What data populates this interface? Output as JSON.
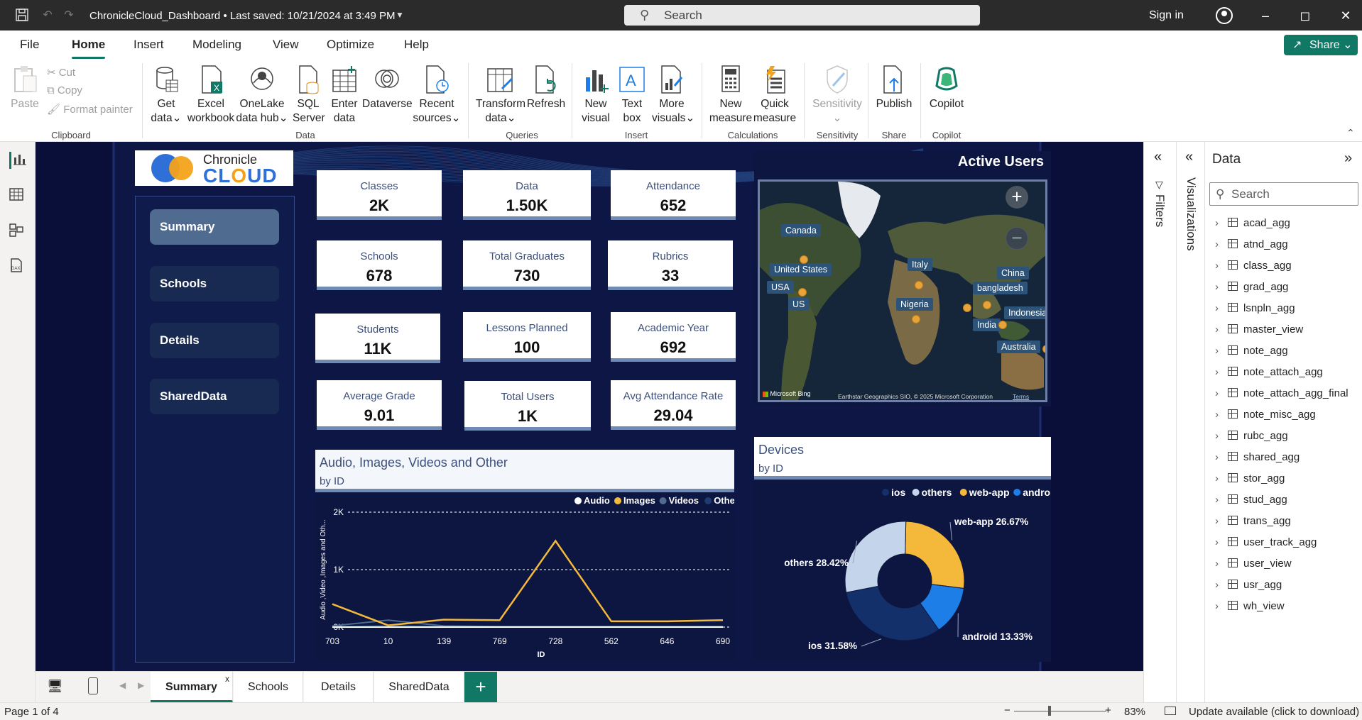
{
  "titlebar": {
    "title": "ChronicleCloud_Dashboard • Last saved: 10/21/2024 at 3:49 PM",
    "search_placeholder": "Search",
    "signin": "Sign in"
  },
  "menu": {
    "tabs": [
      "File",
      "Home",
      "Insert",
      "Modeling",
      "View",
      "Optimize",
      "Help"
    ],
    "share": "Share"
  },
  "ribbon": {
    "clipboard": {
      "paste": "Paste",
      "cut": "Cut",
      "copy": "Copy",
      "format_painter": "Format painter",
      "group": "Clipboard"
    },
    "data": {
      "get_data": [
        "Get",
        "data"
      ],
      "excel": [
        "Excel",
        "workbook"
      ],
      "onelake": [
        "OneLake",
        "data hub"
      ],
      "sql": [
        "SQL",
        "Server"
      ],
      "enter": [
        "Enter",
        "data"
      ],
      "dataverse": "Dataverse",
      "recent": [
        "Recent",
        "sources"
      ],
      "group": "Data"
    },
    "queries": {
      "transform": [
        "Transform",
        "data"
      ],
      "refresh": "Refresh",
      "group": "Queries"
    },
    "insert": {
      "new_visual": [
        "New",
        "visual"
      ],
      "text_box": [
        "Text",
        "box"
      ],
      "more_visuals": [
        "More",
        "visuals"
      ],
      "group": "Insert"
    },
    "calculations": {
      "new_measure": [
        "New",
        "measure"
      ],
      "quick_measure": [
        "Quick",
        "measure"
      ],
      "group": "Calculations"
    },
    "sensitivity": {
      "label": "Sensitivity",
      "group": "Sensitivity"
    },
    "share": {
      "publish": "Publish",
      "group": "Share"
    },
    "copilot": {
      "label": "Copilot",
      "group": "Copilot"
    }
  },
  "report": {
    "logo": {
      "line1": "Chronicle",
      "line2": "CL",
      "line3": "UD"
    },
    "nav": [
      "Summary",
      "Schools",
      "Details",
      "SharedData"
    ],
    "kpis": [
      {
        "label": "Classes",
        "value": "2K"
      },
      {
        "label": "Data",
        "value": "1.50K"
      },
      {
        "label": "Attendance",
        "value": "652"
      },
      {
        "label": "Schools",
        "value": "678"
      },
      {
        "label": "Total Graduates",
        "value": "730"
      },
      {
        "label": "Rubrics",
        "value": "33"
      },
      {
        "label": "Students",
        "value": "11K"
      },
      {
        "label": "Lessons Planned",
        "value": "100"
      },
      {
        "label": "Academic Year",
        "value": "692"
      },
      {
        "label": "Average Grade",
        "value": "9.01"
      },
      {
        "label": "Total Users",
        "value": "1K"
      },
      {
        "label": "Avg Attendance Rate",
        "value": "29.04"
      }
    ],
    "map": {
      "title": "Active Users",
      "labels": [
        "Canada",
        "United States",
        "USA",
        "US",
        "Italy",
        "Nigeria",
        "China",
        "bangladesh",
        "India",
        "Indonesia",
        "Australia"
      ],
      "attribution": "Microsoft Bing",
      "copyright": "Earthstar Geographics SIO, © 2025 Microsoft Corporation",
      "terms": "Terms"
    },
    "audio_chart": {
      "title": "Audio, Images, Videos and Other",
      "subtitle": "by ID"
    },
    "devices_chart": {
      "title": "Devices",
      "subtitle": "by ID"
    }
  },
  "chart_data": [
    {
      "type": "line",
      "title": "Audio, Images, Videos and Other",
      "subtitle": "by ID",
      "xlabel": "ID",
      "ylabel": "Audio ,Video ,Images and Oth...",
      "categories": [
        "703",
        "10",
        "139",
        "769",
        "728",
        "562",
        "646",
        "690"
      ],
      "yticks": [
        "0K",
        "1K",
        "2K"
      ],
      "ylim": [
        0,
        2000
      ],
      "grid": true,
      "legend_position": "top-right",
      "series": [
        {
          "name": "Audio",
          "color": "#ffffff",
          "values": [
            0,
            0,
            0,
            0,
            0,
            0,
            0,
            0
          ]
        },
        {
          "name": "Images",
          "color": "#f4b93a",
          "values": [
            400,
            30,
            130,
            120,
            1500,
            100,
            100,
            120
          ]
        },
        {
          "name": "Videos",
          "color": "#4f6b90",
          "values": [
            20,
            120,
            20,
            10,
            10,
            10,
            10,
            10
          ]
        },
        {
          "name": "Other",
          "color": "#1f3b73",
          "values": [
            0,
            30,
            10,
            0,
            0,
            0,
            0,
            0
          ]
        }
      ]
    },
    {
      "type": "pie",
      "title": "Devices",
      "subtitle": "by ID",
      "legend_position": "top-right",
      "slices": [
        {
          "name": "web-app",
          "label": "web-app 26.67%",
          "value": 26.67,
          "color": "#f4b93a"
        },
        {
          "name": "android",
          "label": "android 13.33%",
          "value": 13.33,
          "color": "#1e7ee8"
        },
        {
          "name": "ios",
          "label": "ios 31.58%",
          "value": 31.58,
          "color": "#14306b"
        },
        {
          "name": "others",
          "label": "others 28.42%",
          "value": 28.42,
          "color": "#c4d4ea"
        }
      ],
      "legend_order": [
        "ios",
        "others",
        "web-app",
        "android"
      ]
    }
  ],
  "panes": {
    "filters": "Filters",
    "visualizations": "Visualizations",
    "data": "Data",
    "data_search": "Search",
    "tables": [
      "acad_agg",
      "atnd_agg",
      "class_agg",
      "grad_agg",
      "lsnpln_agg",
      "master_view",
      "note_agg",
      "note_attach_agg",
      "note_attach_agg_final",
      "note_misc_agg",
      "rubc_agg",
      "shared_agg",
      "stor_agg",
      "stud_agg",
      "trans_agg",
      "user_track_agg",
      "user_view",
      "usr_agg",
      "wh_view"
    ]
  },
  "pages": {
    "tabs": [
      "Summary",
      "Schools",
      "Details",
      "SharedData"
    ],
    "close": "x"
  },
  "status": {
    "page": "Page 1 of 4",
    "zoom": "83%",
    "update": "Update available (click to download)"
  }
}
